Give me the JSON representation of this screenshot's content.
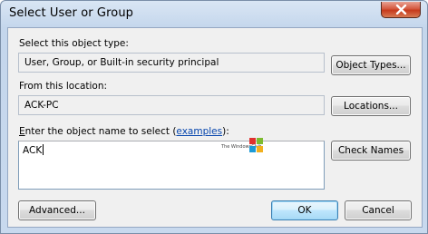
{
  "window": {
    "title": "Select User or Group"
  },
  "object_type": {
    "label": "Select this object type:",
    "value": "User, Group, or Built-in security principal",
    "button_label": "Object Types..."
  },
  "location": {
    "label": "From this location:",
    "value": "ACK-PC",
    "button_label": "Locations..."
  },
  "object_name": {
    "label_before_link": "Enter the object name to select (",
    "label_accel": "E",
    "label_rest": "nter the object name to select (",
    "link_text": "examples",
    "label_after_link": "):",
    "value": "ACK",
    "check_names_label": "Check Names"
  },
  "watermark": {
    "text": "The WindowsClub",
    "colors": [
      "#e0312f",
      "#7dbb2f",
      "#1c9ad6",
      "#f2b01e"
    ]
  },
  "footer": {
    "advanced_label": "Advanced...",
    "ok_label": "OK",
    "cancel_label": "Cancel"
  }
}
